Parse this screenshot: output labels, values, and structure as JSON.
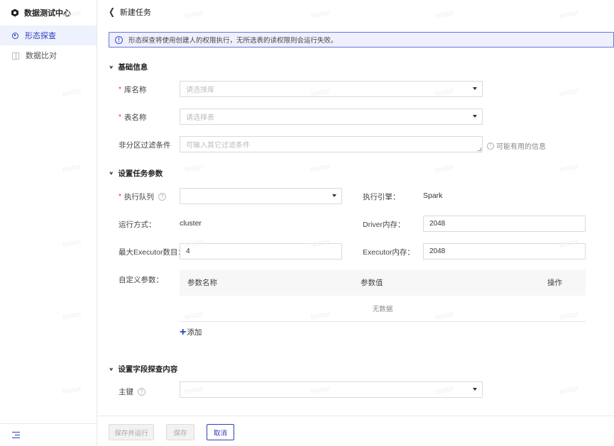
{
  "sidebar": {
    "brand": "数据测试中心",
    "items": [
      {
        "label": "形态探查",
        "active": true
      },
      {
        "label": "数据比对",
        "active": false
      }
    ]
  },
  "header": {
    "title": "新建任务"
  },
  "notice": {
    "text": "形态探查将使用创建人的权限执行，无所选表的读权限则会运行失败。"
  },
  "basic": {
    "title": "基础信息",
    "db_label": "库名称",
    "db_placeholder": "请选择库",
    "table_label": "表名称",
    "table_placeholder": "请选择表",
    "filter_label": "非分区过滤条件",
    "filter_placeholder": "可输入其它过滤条件",
    "filter_hint": "可能有用的信息"
  },
  "params": {
    "title": "设置任务参数",
    "queue_label": "执行队列",
    "queue_value": "",
    "engine_label": "执行引擎：",
    "engine_value": "Spark",
    "run_mode_label": "运行方式：",
    "run_mode_value": "cluster",
    "driver_mem_label": "Driver内存：",
    "driver_mem_value": "2048",
    "max_exec_label": "最大Executor数目：",
    "max_exec_value": "4",
    "exec_mem_label": "Executor内存：",
    "exec_mem_value": "2048",
    "custom_label": "自定义参数：",
    "table": {
      "columns": [
        "参数名称",
        "参数值",
        "操作"
      ],
      "empty_text": "无数据"
    },
    "add_label": "添加"
  },
  "probe": {
    "title": "设置字段探查内容",
    "pk_label": "主键",
    "pk_value": ""
  },
  "footer": {
    "save_run": "保存并运行",
    "save": "保存",
    "cancel": "取消"
  },
  "watermark": "testqx",
  "colors": {
    "accent": "#2f3fb7",
    "required": "#e03030"
  }
}
